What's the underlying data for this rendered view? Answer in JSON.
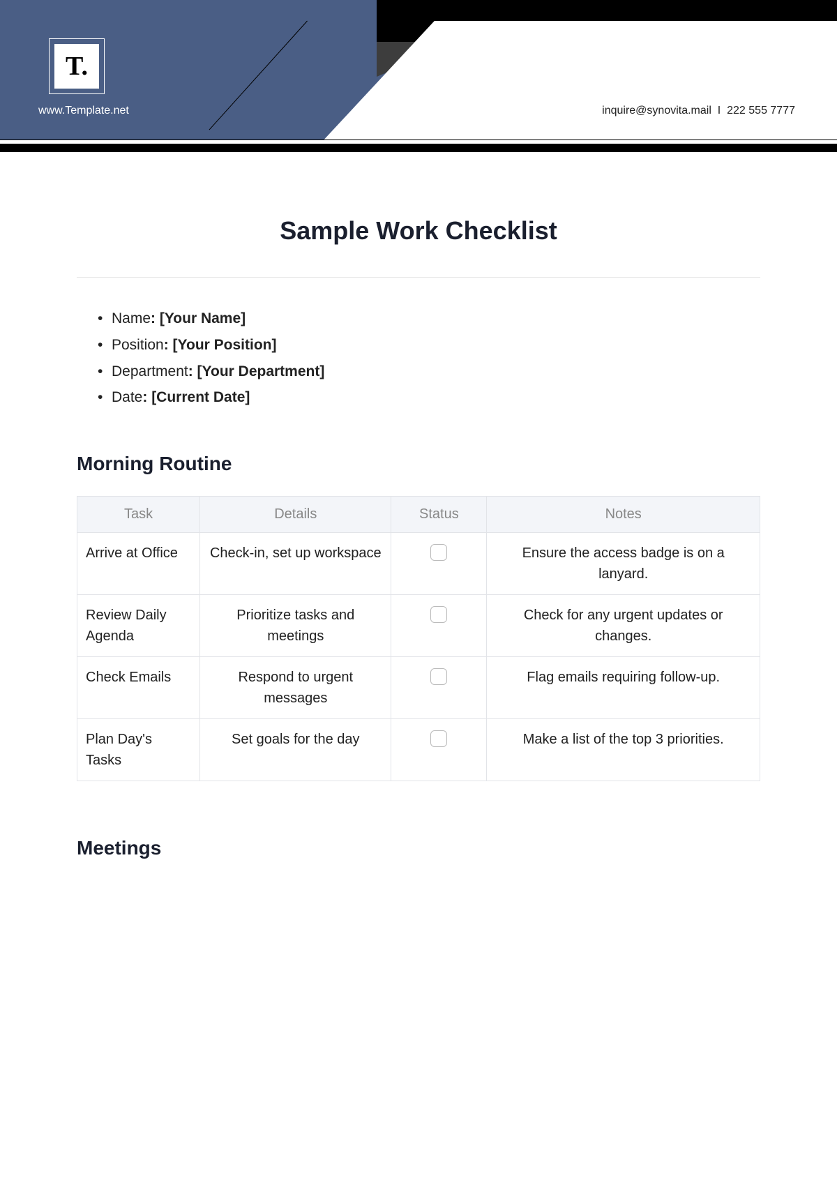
{
  "header": {
    "logo_text": "T.",
    "site_url": "www.Template.net",
    "contact_email": "inquire@synovita.mail",
    "contact_phone": "222 555 7777"
  },
  "title": "Sample Work Checklist",
  "info": [
    {
      "label": "Name",
      "value": "[Your Name]"
    },
    {
      "label": "Position",
      "value": "[Your Position]"
    },
    {
      "label": "Department",
      "value": "[Your Department]"
    },
    {
      "label": "Date",
      "value": "[Current Date]"
    }
  ],
  "sections": [
    {
      "heading": "Morning Routine",
      "columns": [
        "Task",
        "Details",
        "Status",
        "Notes"
      ],
      "rows": [
        {
          "task": "Arrive at Office",
          "details": "Check-in, set up workspace",
          "notes": "Ensure the access badge is on a lanyard."
        },
        {
          "task": "Review Daily Agenda",
          "details": "Prioritize tasks and meetings",
          "notes": "Check for any urgent updates or changes."
        },
        {
          "task": "Check Emails",
          "details": "Respond to urgent messages",
          "notes": "Flag emails requiring follow-up."
        },
        {
          "task": "Plan Day's Tasks",
          "details": "Set goals for the day",
          "notes": "Make a list of the top 3 priorities."
        }
      ]
    },
    {
      "heading": "Meetings"
    }
  ]
}
